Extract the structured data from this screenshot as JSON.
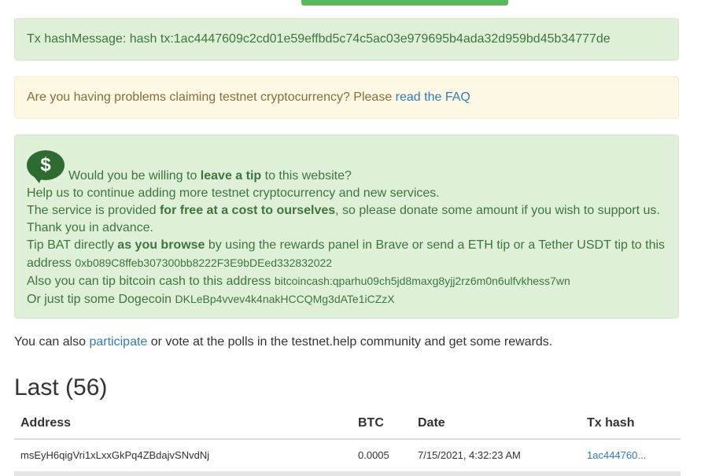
{
  "colors": {
    "success_bg": "#dff0d8",
    "success_text": "#3c763d",
    "warning_bg": "#fcf8e3",
    "warning_text": "#8a6d3b",
    "link": "#337ab7",
    "top_button": "#5cb85c"
  },
  "tx_alert": {
    "label": "Tx hashMessage: hash tx:",
    "hash": "1ac4447609c2cd01e59effbd5c74c5ac03e979695b4ada32d959bd45b34777de"
  },
  "faq_alert": {
    "text": "Are you having problems claiming testnet cryptocurrency? Please ",
    "link": "read the FAQ"
  },
  "tip": {
    "icon": "dollar-speech-bubble-icon",
    "icon_glyph": "$",
    "line1_pre": "Would you be willing to ",
    "line1_bold": "leave a tip",
    "line1_post": " to this website?",
    "line2": "Help us to continue adding more testnet cryptocurrency and new services.",
    "line3_pre": "The service is provided ",
    "line3_bold": "for free at a cost to ourselves",
    "line3_post": ", so please donate some amount if you wish to support us.",
    "line4": "Thank you in advance.",
    "line5_pre": "Tip BAT directly ",
    "line5_bold": "as you browse",
    "line5_post": " by using the rewards panel in Brave or send a ETH tip or a Tether USDT tip to this address ",
    "eth_address": "0xb089C8ffeb307300bb8222F3E9bDEed332832022",
    "line6_pre": "Also you can tip bitcoin cash to this address ",
    "bch_address": "bitcoincash:qparhu09ch5jd8maxg8yjj2rz6m0n6ulfvkhess7wn",
    "line7_pre": "Or just tip some Dogecoin ",
    "doge_address": "DKLeBp4vvev4k4nakHCCQMg3dATe1iCZzX"
  },
  "participate": {
    "pre": "You can also ",
    "link": "participate",
    "post": " or vote at the polls in the testnet.help community and get some rewards."
  },
  "last": {
    "title": "Last (56)",
    "columns": [
      "Address",
      "BTC",
      "Date",
      "Tx hash"
    ],
    "rows": [
      {
        "address": "msEyH6qigVri1xLxxGkPq4ZBdajvSNvdNj",
        "btc": "0.0005",
        "date": "7/15/2021, 4:32:23 AM",
        "tx": "1ac444760..."
      }
    ]
  }
}
